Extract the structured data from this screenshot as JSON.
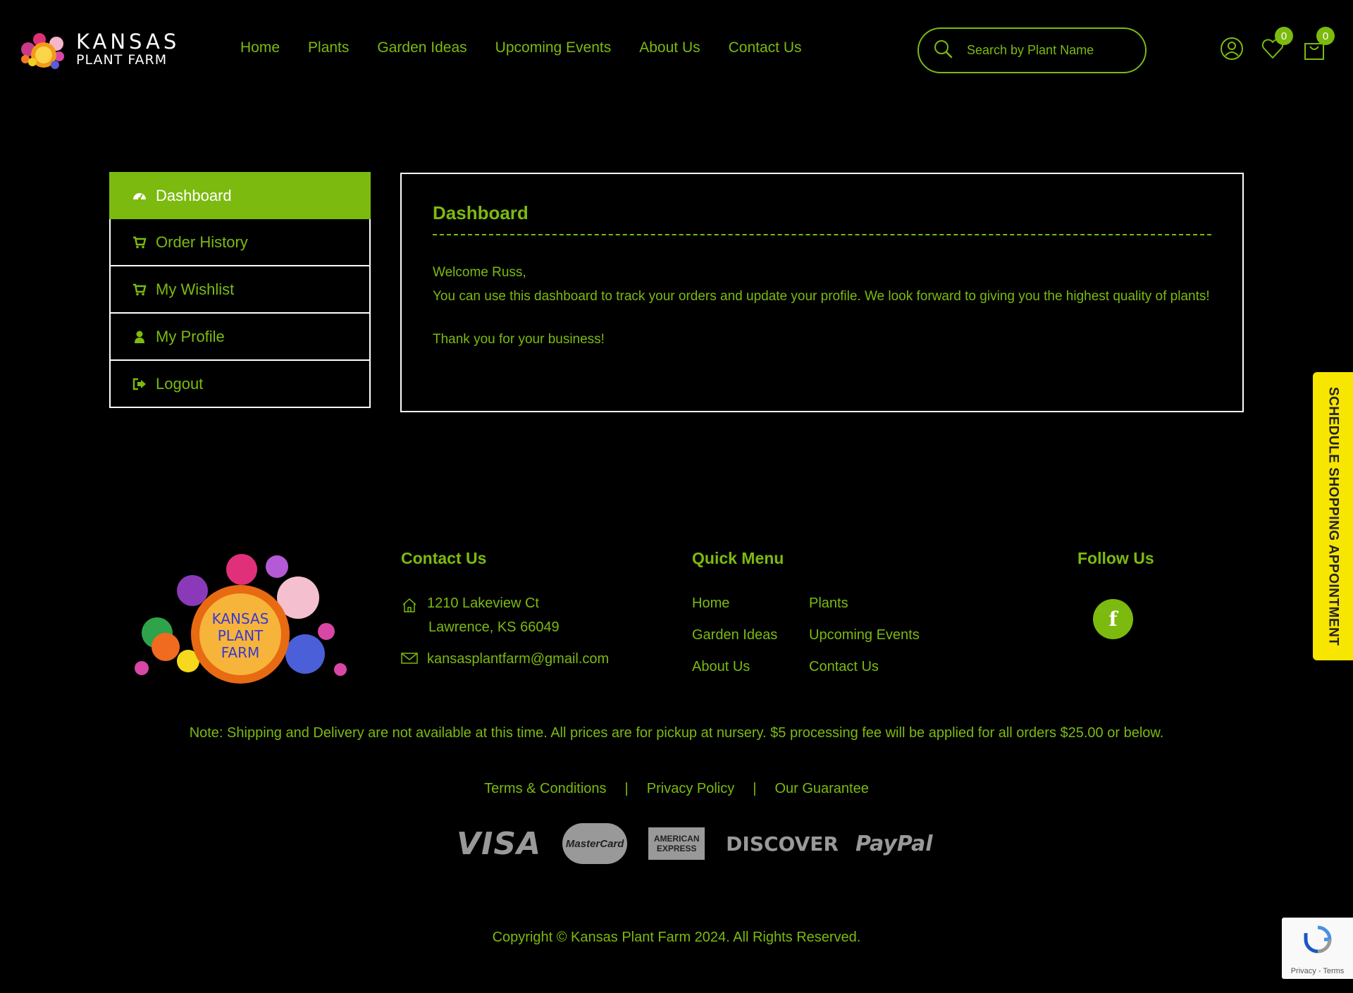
{
  "brand": {
    "line1": "KANSAS",
    "line2": "PLANT FARM"
  },
  "nav": [
    "Home",
    "Plants",
    "Garden Ideas",
    "Upcoming Events",
    "About Us",
    "Contact Us"
  ],
  "search": {
    "placeholder": "Search by Plant Name"
  },
  "header": {
    "wishlist_count": "0",
    "cart_count": "0"
  },
  "sidebar": {
    "items": [
      {
        "label": "Dashboard",
        "icon": "dashboard-icon",
        "active": true
      },
      {
        "label": "Order History",
        "icon": "cart-icon"
      },
      {
        "label": "My Wishlist",
        "icon": "cart-icon"
      },
      {
        "label": "My Profile",
        "icon": "user-icon"
      },
      {
        "label": "Logout",
        "icon": "logout-icon"
      }
    ]
  },
  "dashboard": {
    "title": "Dashboard",
    "greeting": "Welcome Russ,",
    "body": "You can use this dashboard to track your orders and update your profile. We look forward to giving you the highest quality of plants!",
    "thanks": "Thank you for your business!"
  },
  "schedule_tab": "SCHEDULE SHOPPING APPOINTMENT",
  "footer": {
    "logo_text": [
      "KANSAS",
      "PLANT",
      "FARM"
    ],
    "contact": {
      "heading": "Contact Us",
      "address1": "1210 Lakeview Ct",
      "address2": "Lawrence, KS 66049",
      "email": "kansasplantfarm@gmail.com"
    },
    "quick_menu": {
      "heading": "Quick Menu",
      "col1": [
        "Home",
        "Garden Ideas",
        "About Us"
      ],
      "col2": [
        "Plants",
        "Upcoming Events",
        "Contact Us"
      ]
    },
    "follow": {
      "heading": "Follow Us",
      "facebook": "f"
    },
    "note": "Note: Shipping and Delivery are not available at this time. All prices are for pickup at nursery. $5 processing fee will be applied for all orders $25.00 or below.",
    "legal": [
      "Terms & Conditions",
      "Privacy Policy",
      "Our Guarantee"
    ],
    "separator": "|",
    "payments": {
      "visa": "VISA",
      "mastercard": "MasterCard",
      "amex1": "AMERICAN",
      "amex2": "EXPRESS",
      "discover": "DISCOVER",
      "paypal": "PayPal"
    },
    "copyright": "Copyright © Kansas Plant Farm 2024. All Rights Reserved."
  },
  "recaptcha": "Privacy - Terms",
  "colors": {
    "accent": "#7cba0f",
    "background": "#000000",
    "schedule_tab": "#f7e600"
  }
}
